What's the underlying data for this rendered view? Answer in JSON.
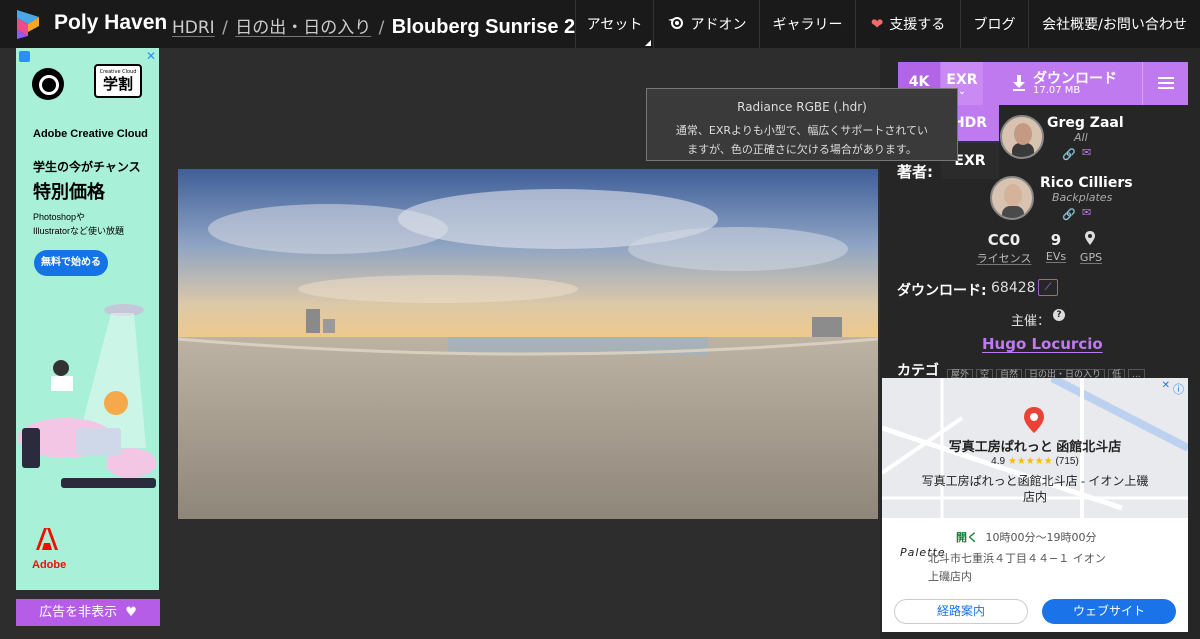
{
  "header": {
    "brand": "Poly Haven",
    "breadcrumb": {
      "root": "HDRI",
      "category": "日の出・日の入り",
      "title": "Blouberg Sunrise 2"
    },
    "nav": [
      {
        "label": "アセット",
        "icon": ""
      },
      {
        "label": "アドオン",
        "icon": "blender-icon"
      },
      {
        "label": "ギャラリー",
        "icon": ""
      },
      {
        "label": "支援する",
        "icon": "heart-icon"
      },
      {
        "label": "ブログ",
        "icon": ""
      },
      {
        "label": "会社概要/お問い合わせ",
        "icon": ""
      }
    ]
  },
  "left_ad": {
    "brand_line": "Adobe Creative Cloud",
    "badge_small": "Creative Cloud",
    "badge_big": "学割",
    "headline1": "学生の今がチャンス",
    "headline2": "特別価格",
    "body1": "Photoshopや",
    "body2": "Illustratorなど使い放題",
    "cta": "無料で始める",
    "footer_brand": "Adobe",
    "hide_ads_label": "広告を非表示"
  },
  "download": {
    "resolution": "4K",
    "format": "EXR",
    "button_label": "ダウンロード",
    "file_size": "17.07 MB",
    "format_options": [
      "HDR",
      "EXR"
    ],
    "tooltip_title": "Radiance RGBE (.hdr)",
    "tooltip_line1": "通常、EXRよりも小型で、幅広くサポートされてい",
    "tooltip_line2": "ますが、色の正確さに欠ける場合があります。"
  },
  "info": {
    "authors_label": "著者:",
    "authors": [
      {
        "name": "Greg Zaal",
        "role": "All"
      },
      {
        "name": "Rico Cilliers",
        "role": "Backplates"
      }
    ],
    "stats": [
      {
        "value": "CC0",
        "label": "ライセンス"
      },
      {
        "value": "9",
        "label": "EVs"
      },
      {
        "value": "",
        "label": "GPS"
      }
    ],
    "downloads_label": "ダウンロード:",
    "downloads_count": "68428",
    "sponsor_label": "主催：",
    "sponsor_name": "Hugo Locurcio",
    "categories_label": "カテゴ",
    "category_tags": [
      "屋外",
      "空",
      "自然",
      "日の出・日の入り",
      "低",
      "..."
    ]
  },
  "right_ad": {
    "place_name": "写真工房ぱれっと 函館北斗店",
    "rating": "4.9",
    "stars": "★★★★★",
    "review_count": "(715)",
    "address_line1": "写真工房ぱれっと函館北斗店 - イオン上磯",
    "address_line2": "店内",
    "logo_text": "Palette",
    "open_label": "開く",
    "hours": "10時00分～19時00分",
    "addr1": "北斗市七重浜４丁目４４−１ イオン",
    "addr2": "上磯店内",
    "route_label": "経路案内",
    "website_label": "ウェブサイト"
  }
}
